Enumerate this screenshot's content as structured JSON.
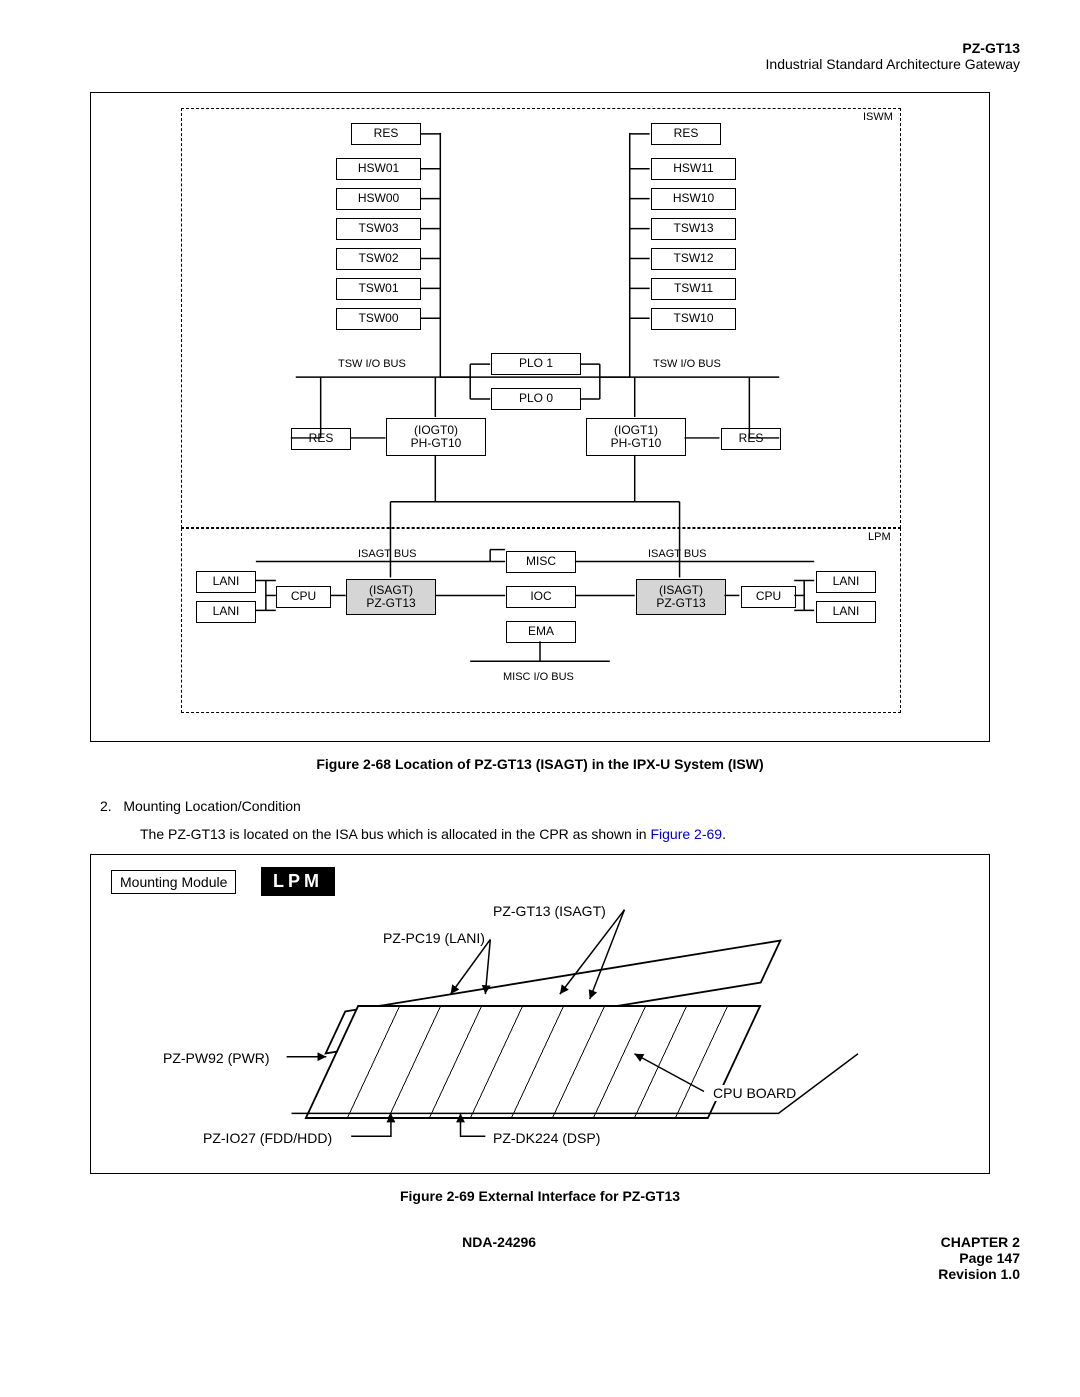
{
  "header": {
    "part_no": "PZ-GT13",
    "subtitle": "Industrial Standard Architecture Gateway"
  },
  "fig68": {
    "iswm_label": "ISWM",
    "lpm_label": "LPM",
    "left_stack": [
      "RES",
      "HSW01",
      "HSW00",
      "TSW03",
      "TSW02",
      "TSW01",
      "TSW00"
    ],
    "right_stack": [
      "RES",
      "HSW11",
      "HSW10",
      "TSW13",
      "TSW12",
      "TSW11",
      "TSW10"
    ],
    "tsw_bus": "TSW I/O BUS",
    "plo1": "PLO 1",
    "plo0": "PLO 0",
    "res": "RES",
    "iogt0": "(IOGT0)",
    "iogt1": "(IOGT1)",
    "phgt10": "PH-GT10",
    "isagt_bus": "ISAGT BUS",
    "lani": "LANI",
    "cpu": "CPU",
    "isagt": "(ISAGT)",
    "pzgt13": "PZ-GT13",
    "misc": "MISC",
    "ioc": "IOC",
    "ema": "EMA",
    "misc_bus": "MISC I/O BUS"
  },
  "caption68": "Figure 2-68   Location of PZ-GT13 (ISAGT) in the IPX-U System (ISW)",
  "section": {
    "num": "2.",
    "title": "Mounting Location/Condition",
    "body_pre": "The PZ-GT13 is located on the ISA bus which is allocated in the CPR as shown in ",
    "body_link": "Figure 2-69",
    "body_post": "."
  },
  "fig69": {
    "mounting": "Mounting Module",
    "lpm": "LPM",
    "labels": {
      "isagt": "PZ-GT13 (ISAGT)",
      "lani": "PZ-PC19 (LANI)",
      "pwr": "PZ-PW92 (PWR)",
      "fdd": "PZ-IO27 (FDD/HDD)",
      "dsp": "PZ-DK224 (DSP)",
      "cpu": "CPU BOARD"
    }
  },
  "caption69": "Figure 2-69   External Interface for PZ-GT13",
  "footer": {
    "doc_no": "NDA-24296",
    "chapter": "CHAPTER 2",
    "page": "Page 147",
    "revision": "Revision 1.0"
  }
}
